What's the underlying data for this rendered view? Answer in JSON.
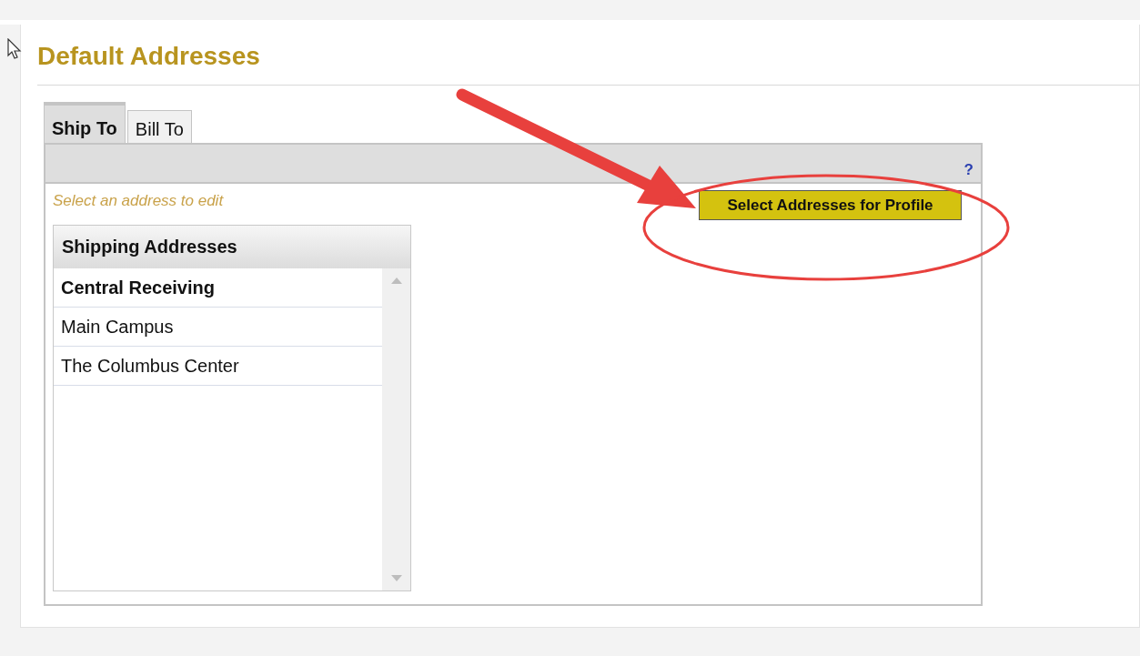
{
  "page": {
    "title": "Default Addresses"
  },
  "tabs": [
    {
      "label": "Ship To",
      "selected": true
    },
    {
      "label": "Bill To",
      "selected": false
    }
  ],
  "panel": {
    "help": "?",
    "hint": "Select an address to edit",
    "button": "Select Addresses for Profile"
  },
  "address_list": {
    "title": "Shipping Addresses",
    "items": [
      {
        "label": "Central Receiving",
        "selected": true
      },
      {
        "label": "Main Campus",
        "selected": false
      },
      {
        "label": "The Columbus Center",
        "selected": false
      }
    ]
  }
}
